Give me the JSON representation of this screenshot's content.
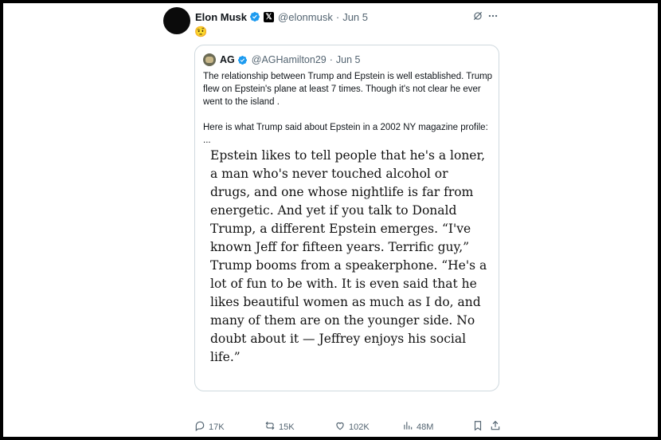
{
  "post": {
    "author_name": "Elon Musk",
    "handle": "@elonmusk",
    "separator": "·",
    "time": "Jun 5",
    "emoji": "🤨"
  },
  "quote": {
    "author_name": "AG",
    "handle": "@AGHamilton29",
    "separator": "·",
    "time": "Jun 5",
    "text": "The relationship between Trump and Epstein is well established. Trump flew on Epstein's plane at least 7 times. Though it's not clear he ever went to the island .\n\nHere is what Trump said about Epstein in a 2002 NY magazine profile: ...",
    "excerpt": "Epstein likes to tell people that he's a loner, a man who's never touched alcohol or drugs, and one whose nightlife is far from energetic. And yet if you talk to Donald Trump, a different Epstein emerges. “I've known Jeff for fifteen years. Terrific guy,” Trump booms from a speakerphone. “He's a lot of fun to be with. It is even said that he likes beautiful women as much as I do, and many of them are on the younger side. No doubt about it — Jeffrey enjoys his social life.”"
  },
  "actions": {
    "replies": "17K",
    "reposts": "15K",
    "likes": "102K",
    "views": "48M"
  },
  "icons": [
    "verified-badge-icon",
    "x-affiliate-badge-icon",
    "grok-icon",
    "more-icon",
    "reply-icon",
    "repost-icon",
    "like-icon",
    "views-icon",
    "bookmark-icon",
    "share-icon"
  ],
  "colors": {
    "verified": "#1d9bf0",
    "muted": "#536471",
    "border": "#cfd9de"
  }
}
